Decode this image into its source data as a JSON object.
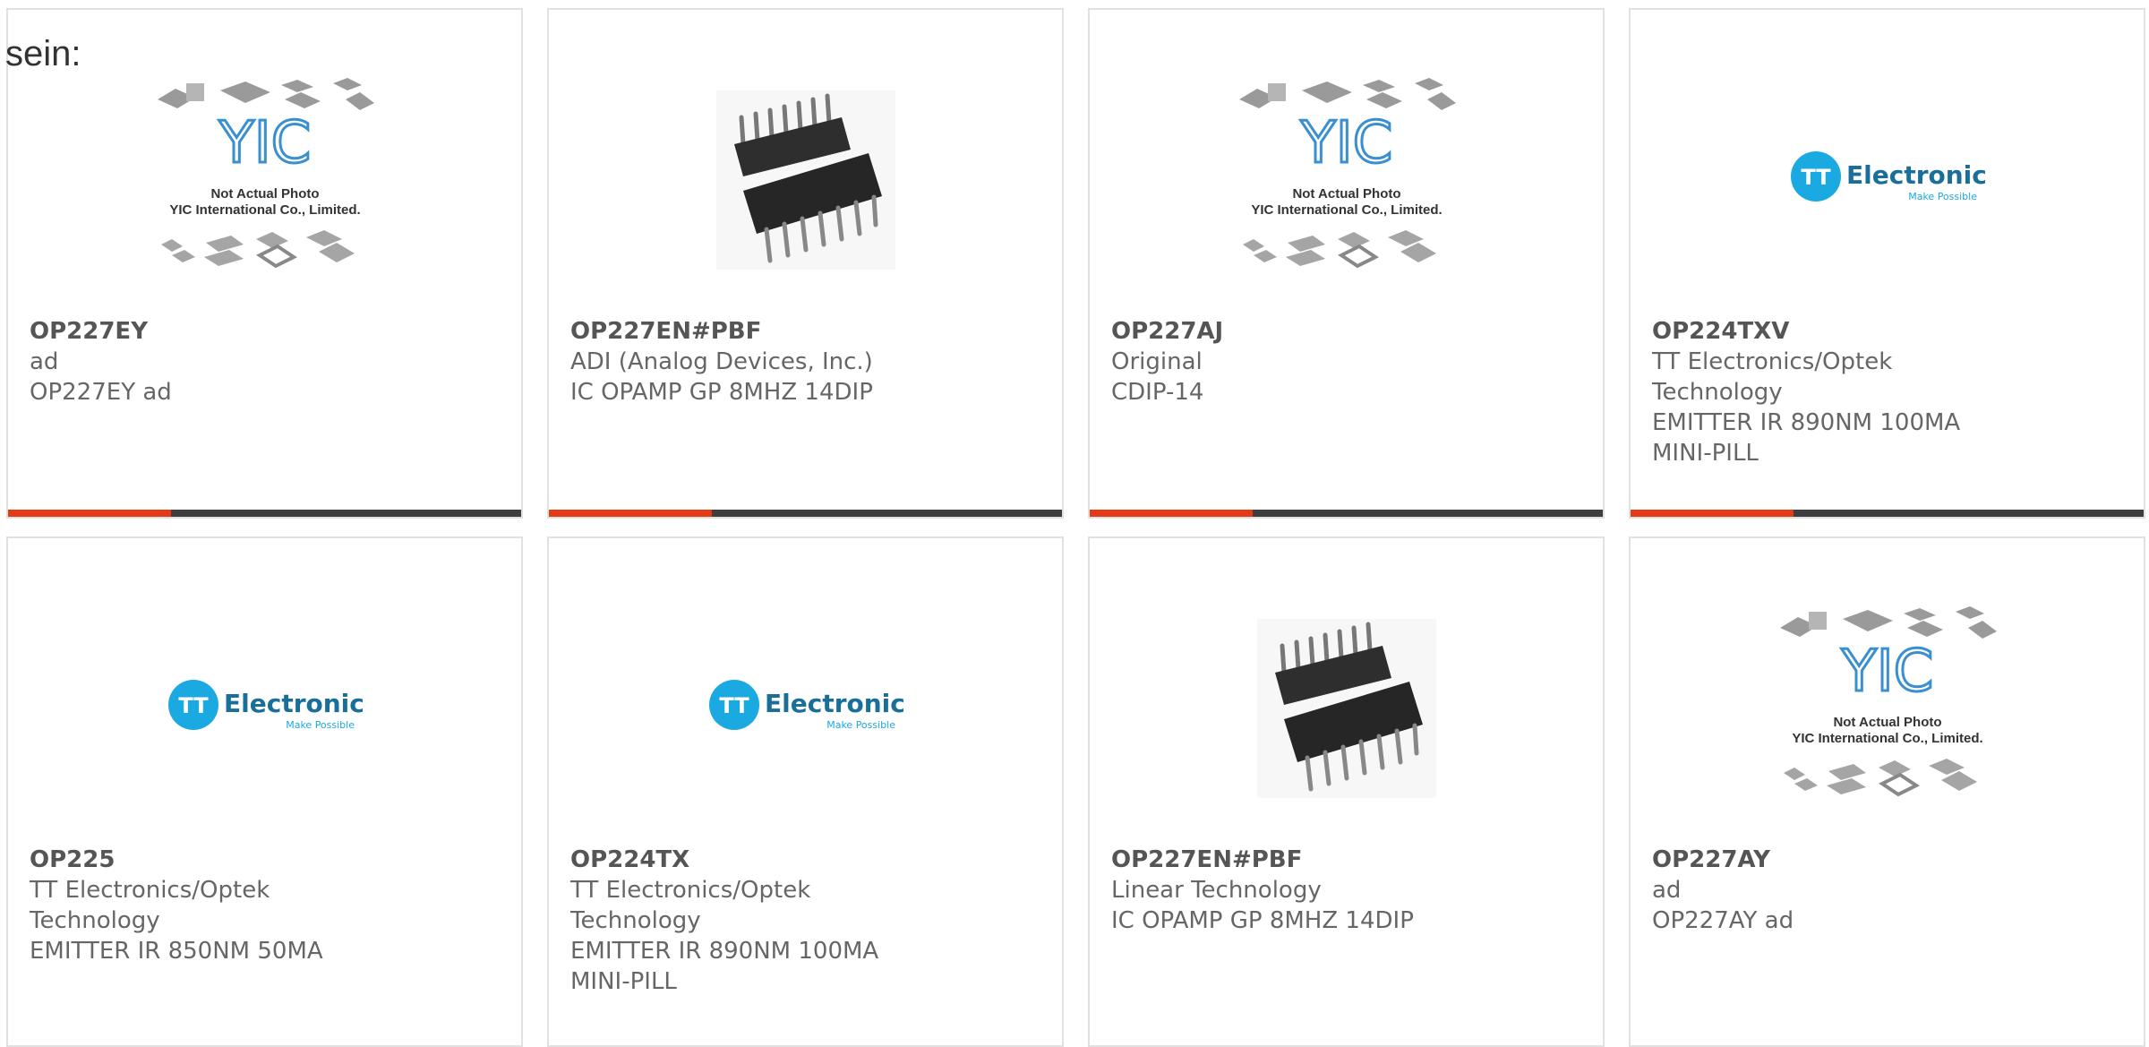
{
  "page": {
    "fragment_text": "sein:"
  },
  "products": [
    {
      "part": "OP227EY",
      "maker": "ad",
      "desc": "OP227EY ad",
      "image": "yic-placeholder"
    },
    {
      "part": "OP227EN#PBF",
      "maker": "ADI (Analog Devices, Inc.)",
      "desc": "IC OPAMP GP 8MHZ 14DIP",
      "image": "dip-chip"
    },
    {
      "part": "OP227AJ",
      "maker": "Original",
      "desc": "CDIP-14",
      "image": "yic-placeholder"
    },
    {
      "part": "OP224TXV",
      "maker": "TT Electronics/Optek Technology",
      "desc": "EMITTER IR 890NM 100MA MINI-PILL",
      "image": "tt-logo"
    },
    {
      "part": "OP225",
      "maker": "TT Electronics/Optek Technology",
      "desc": "EMITTER IR 850NM 50MA",
      "image": "tt-logo"
    },
    {
      "part": "OP224TX",
      "maker": "TT Electronics/Optek Technology",
      "desc": "EMITTER IR 890NM 100MA MINI-PILL",
      "image": "tt-logo"
    },
    {
      "part": "OP227EN#PBF",
      "maker": "Linear Technology",
      "desc": "IC OPAMP GP 8MHZ 14DIP",
      "image": "dip-chip"
    },
    {
      "part": "OP227AY",
      "maker": "ad",
      "desc": "OP227AY ad",
      "image": "yic-placeholder"
    }
  ],
  "images": {
    "yic_line1": "Not Actual Photo",
    "yic_line2": "YIC International Co., Limited.",
    "yic_logo": "YIC",
    "tt_logo_main": "Electronics",
    "tt_logo_sub": "Make Possible",
    "tt_logo_mark": "TT"
  },
  "colors": {
    "accent": "#e43b17",
    "bar": "#3e3e3e",
    "tt_blue": "#1aa9e1"
  }
}
